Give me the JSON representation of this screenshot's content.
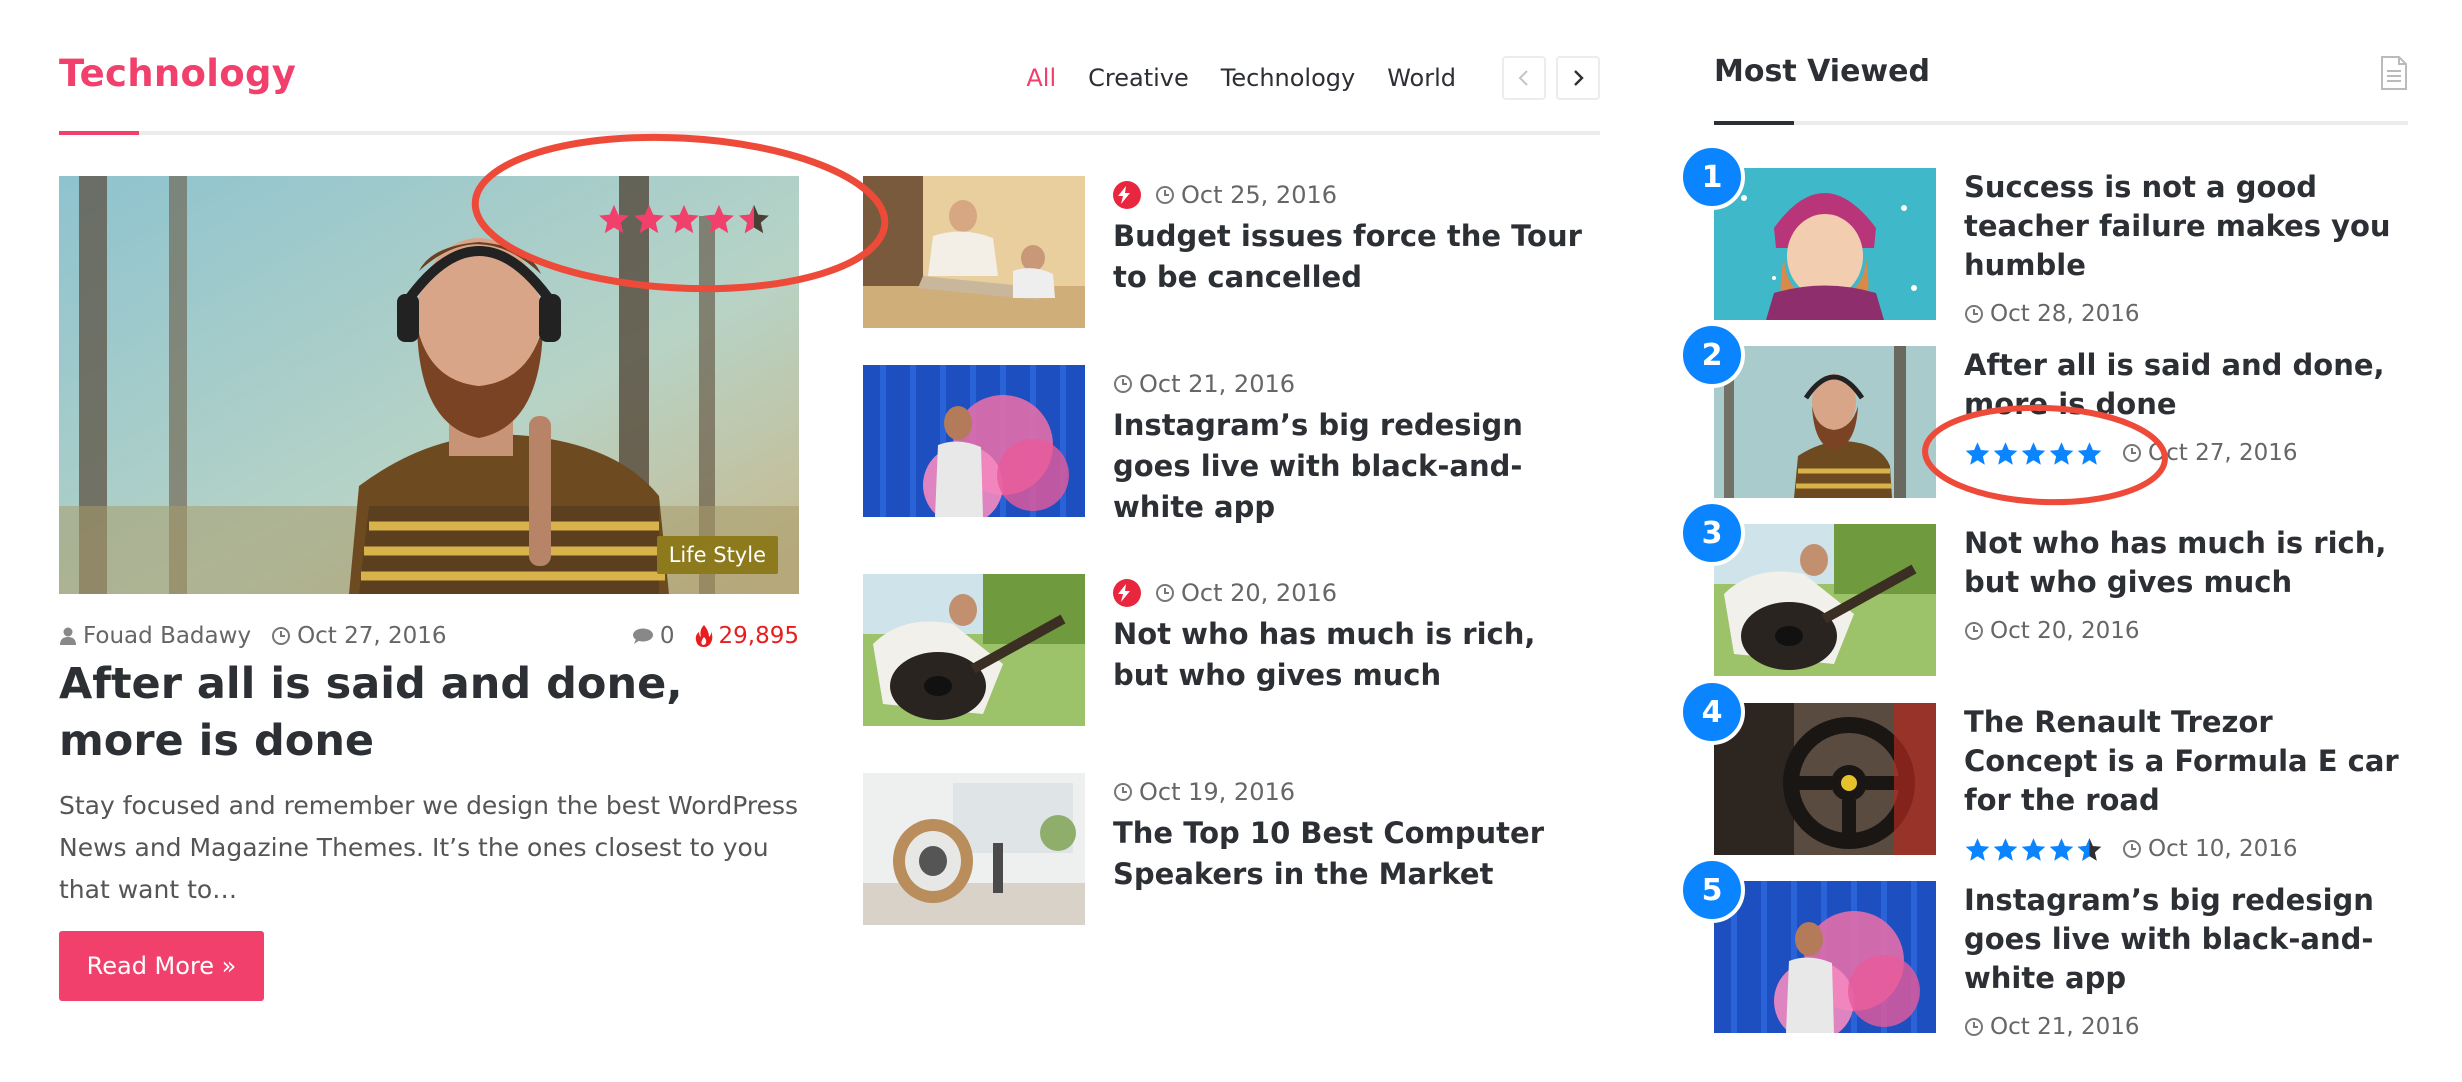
{
  "technology": {
    "title": "Technology",
    "filters": [
      "All",
      "Creative",
      "Technology",
      "World"
    ],
    "active_filter": "All",
    "featured": {
      "category": "Life Style",
      "rating_stars": 4.5,
      "author": "Fouad Badawy",
      "date": "Oct 27, 2016",
      "comments": "0",
      "views": "29,895",
      "title": "After all is said and done, more is done",
      "excerpt": "Stay focused and remember we design the best WordPress News and Magazine Themes. It’s the ones closest to you that want to…",
      "read_more": "Read More »"
    },
    "posts": [
      {
        "date": "Oct 25, 2016",
        "title": "Budget issues force the Tour to be cancelled",
        "trending": true
      },
      {
        "date": "Oct 21, 2016",
        "title": "Instagram’s big redesign goes live with black-and-white app",
        "trending": false
      },
      {
        "date": "Oct 20, 2016",
        "title": "Not who has much is rich, but who gives much",
        "trending": true
      },
      {
        "date": "Oct 19, 2016",
        "title": "The Top 10 Best Computer Speakers in the Market",
        "trending": false
      }
    ]
  },
  "most_viewed": {
    "title": "Most Viewed",
    "items": [
      {
        "rank": "1",
        "title": "Success is not a good teacher failure makes you humble",
        "date": "Oct 28, 2016"
      },
      {
        "rank": "2",
        "title": "After all is said and done, more is done",
        "date": "Oct 27, 2016",
        "rating_stars": 5
      },
      {
        "rank": "3",
        "title": "Not who has much is rich, but who gives much",
        "date": "Oct 20, 2016"
      },
      {
        "rank": "4",
        "title": "The Renault Trezor Concept is a Formula E car for the road",
        "date": "Oct 10, 2016",
        "rating_stars": 4.5
      },
      {
        "rank": "5",
        "title": "Instagram’s big redesign goes live with black-and-white app",
        "date": "Oct 21, 2016"
      }
    ]
  },
  "colors": {
    "accent": "#f0406b",
    "rank_badge": "#0a85ff",
    "views": "#e81d1d",
    "category_badge": "#8c7a1d",
    "annotation": "#ee4a3a"
  },
  "icons": [
    "user-icon",
    "clock-icon",
    "comment-icon",
    "fire-icon",
    "bolt-icon",
    "star-icon",
    "chevron-left-icon",
    "chevron-right-icon",
    "document-icon"
  ]
}
